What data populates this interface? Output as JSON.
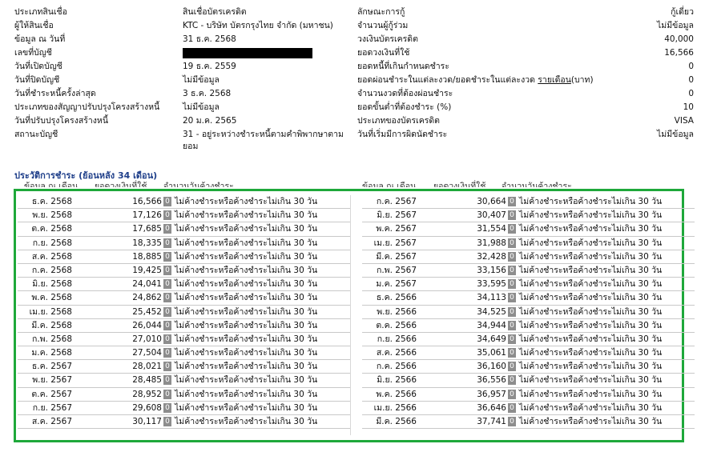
{
  "info": {
    "rows": [
      {
        "l1": "ประเภทสินเชื่อ",
        "v1": "สินเชื่อบัตรเครดิต",
        "l2": "ลักษณะการกู้",
        "v2": "กู้เดี่ยว"
      },
      {
        "l1": "ผู้ให้สินเชื่อ",
        "v1": "KTC - บริษัท บัตรกรุงไทย จำกัด (มหาชน)",
        "l2": "จำนวนผู้กู้ร่วม",
        "v2": "ไม่มีข้อมูล"
      },
      {
        "l1": "ข้อมูล ณ วันที่",
        "v1": "31 ธ.ค. 2568",
        "l2": "วงเงินบัตรเครดิต",
        "v2": "40,000"
      },
      {
        "l1": "เลขที่บัญชี",
        "v1": "",
        "l2": "ยอดวงเงินที่ใช้",
        "v2": "16,566"
      },
      {
        "l1": "วันที่เปิดบัญชี",
        "v1": "19 ธ.ค. 2559",
        "l2": "ยอดหนี้ที่เกินกำหนดชำระ",
        "v2": "0"
      },
      {
        "l1": "วันที่ปิดบัญชี",
        "v1": "ไม่มีข้อมูล",
        "l2": "ยอดผ่อนชำระในแต่ละงวด/ยอดชำระในแต่ละงวด",
        "l2_link": "รายเดือน",
        "l2_tail": "(บาท)",
        "v2": "0"
      },
      {
        "l1": "วันที่ชำระหนี้ครั้งล่าสุด",
        "v1": "3 ธ.ค. 2568",
        "l2": "จำนวนงวดที่ต้องผ่อนชำระ",
        "v2": "0"
      },
      {
        "l1": "ประเภทของสัญญาปรับปรุงโครงสร้างหนี้",
        "v1": "ไม่มีข้อมูล",
        "l2": "ยอดขั้นต่ำที่ต้องชำระ (%)",
        "v2": "10"
      },
      {
        "l1": "วันที่ปรับปรุงโครงสร้างหนี้",
        "v1": "20 ม.ค. 2565",
        "l2": "ประเภทของบัตรเครดิต",
        "v2": "VISA"
      },
      {
        "l1": "สถานะบัญชี",
        "v1": "31 - อยู่ระหว่างชำระหนี้ตามคำพิพากษาตามยอม",
        "l2": "วันที่เริ่มมีการผิดนัดชำระ",
        "v2": "ไม่มีข้อมูล"
      }
    ]
  },
  "history": {
    "title": "ประวัติการชำระ (ย้อนหลัง 34 เดือน)",
    "headers": {
      "date": "ข้อมูล ณ เดือน",
      "amount": "ยอดวงเงินที่ใช้",
      "status": "จำนวนวันค้างชำระ"
    },
    "status_text": "ไม่ค้างชำระหรือค้างชำระไม่เกิน 30 วัน",
    "badge": "0",
    "left": [
      {
        "date": "ธ.ค. 2568",
        "amount": "16,566"
      },
      {
        "date": "พ.ย. 2568",
        "amount": "17,126"
      },
      {
        "date": "ต.ค. 2568",
        "amount": "17,685"
      },
      {
        "date": "ก.ย. 2568",
        "amount": "18,335"
      },
      {
        "date": "ส.ค. 2568",
        "amount": "18,885"
      },
      {
        "date": "ก.ค. 2568",
        "amount": "19,425"
      },
      {
        "date": "มิ.ย. 2568",
        "amount": "24,041"
      },
      {
        "date": "พ.ค. 2568",
        "amount": "24,862"
      },
      {
        "date": "เม.ย. 2568",
        "amount": "25,452"
      },
      {
        "date": "มี.ค. 2568",
        "amount": "26,044"
      },
      {
        "date": "ก.พ. 2568",
        "amount": "27,010"
      },
      {
        "date": "ม.ค. 2568",
        "amount": "27,504"
      },
      {
        "date": "ธ.ค. 2567",
        "amount": "28,021"
      },
      {
        "date": "พ.ย. 2567",
        "amount": "28,485"
      },
      {
        "date": "ต.ค. 2567",
        "amount": "28,952"
      },
      {
        "date": "ก.ย. 2567",
        "amount": "29,608"
      },
      {
        "date": "ส.ค. 2567",
        "amount": "30,117"
      }
    ],
    "right": [
      {
        "date": "ก.ค. 2567",
        "amount": "30,664"
      },
      {
        "date": "มิ.ย. 2567",
        "amount": "30,407"
      },
      {
        "date": "พ.ค. 2567",
        "amount": "31,554"
      },
      {
        "date": "เม.ย. 2567",
        "amount": "31,988"
      },
      {
        "date": "มี.ค. 2567",
        "amount": "32,428"
      },
      {
        "date": "ก.พ. 2567",
        "amount": "33,156"
      },
      {
        "date": "ม.ค. 2567",
        "amount": "33,595"
      },
      {
        "date": "ธ.ค. 2566",
        "amount": "34,113"
      },
      {
        "date": "พ.ย. 2566",
        "amount": "34,525"
      },
      {
        "date": "ต.ค. 2566",
        "amount": "34,944"
      },
      {
        "date": "ก.ย. 2566",
        "amount": "34,649"
      },
      {
        "date": "ส.ค. 2566",
        "amount": "35,061"
      },
      {
        "date": "ก.ค. 2566",
        "amount": "36,160"
      },
      {
        "date": "มิ.ย. 2566",
        "amount": "36,556"
      },
      {
        "date": "พ.ค. 2566",
        "amount": "36,957"
      },
      {
        "date": "เม.ย. 2566",
        "amount": "36,646"
      },
      {
        "date": "มี.ค. 2566",
        "amount": "37,741"
      }
    ]
  },
  "colors": {
    "highlight_border": "#1ea83a",
    "title": "#1f3f8a",
    "badge": "#8d8d8d"
  }
}
